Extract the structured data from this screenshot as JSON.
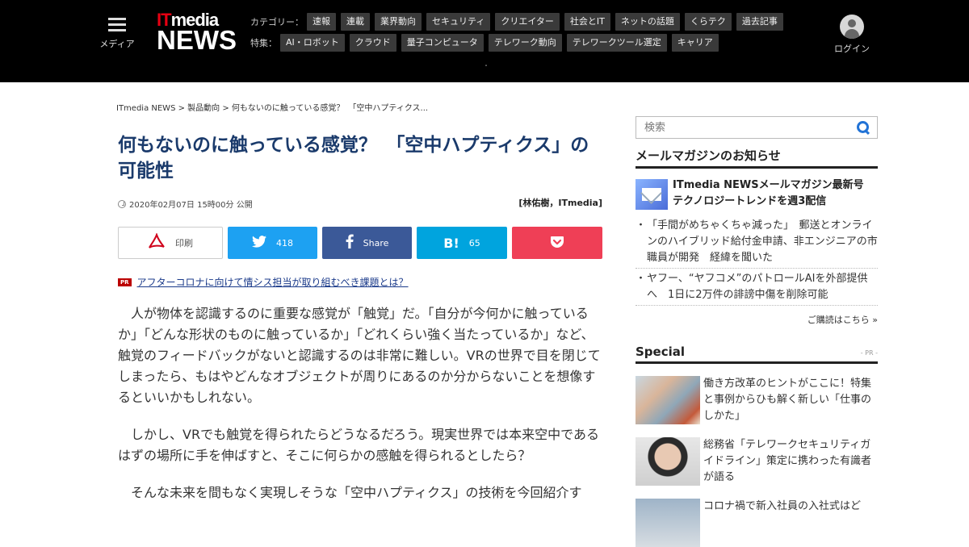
{
  "header": {
    "menu_label": "メディア",
    "logo_it": "IT",
    "logo_media": "media",
    "logo_news": "NEWS",
    "category_label": "カテゴリー：",
    "categories": [
      "速報",
      "連載",
      "業界動向",
      "セキュリティ",
      "クリエイター",
      "社会とIT",
      "ネットの話題",
      "くらテク",
      "過去記事"
    ],
    "feature_label": "特集：",
    "features": [
      "AI・ロボット",
      "クラウド",
      "量子コンピュータ",
      "テレワーク動向",
      "テレワークツール選定",
      "キャリア"
    ],
    "nav_dot": "・",
    "login_label": "ログイン"
  },
  "article": {
    "breadcrumb": [
      "ITmedia NEWS",
      "製品動向",
      "何もないのに触っている感覚？　「空中ハプティクス..."
    ],
    "breadcrumb_sep": " > ",
    "title": "何もないのに触っている感覚？　「空中ハプティクス」の可能性",
    "date": "2020年02月07日 15時00分 公開",
    "author": "[林佑樹，ITmedia]",
    "share": {
      "print_label": "印刷",
      "twitter_count": "418",
      "facebook_label": "Share",
      "hatena_icon": "B!",
      "hatena_count": "65"
    },
    "pr_badge": "PR",
    "pr_link": "アフターコロナに向けて情シス担当が取り組むべき課題とは？",
    "paragraphs": [
      "人が物体を認識するのに重要な感覚が「触覚」だ。「自分が今何かに触っているか」「どんな形状のものに触っているか」「どれくらい強く当たっているか」など、触覚のフィードバックがないと認識するのは非常に難しい。VRの世界で目を閉じてしまったら、もはやどんなオブジェクトが周りにあるのか分からないことを想像するといいかもしれない。",
      "しかし、VRでも触覚を得られたらどうなるだろう。現実世界では本来空中であるはずの場所に手を伸ばすと、そこに何らかの感触を得られるとしたら？",
      "そんな未来を間もなく実現しそうな「空中ハプティクス」の技術を今回紹介す"
    ]
  },
  "sidebar": {
    "search_placeholder": "検索",
    "mail_title": "メールマガジンのお知らせ",
    "mail_feature": "ITmedia NEWSメールマガジン最新号\nテクノロジートレンドを週3配信",
    "mail_items": [
      "「手間がめちゃくちゃ減った」　郵送とオンラインのハイブリッド給付金申請、非エンジニアの市職員が開発　経緯を聞いた",
      "ヤフー、“ヤフコメ”のパトロールAIを外部提供へ　1日に2万件の誹謗中傷を削除可能"
    ],
    "subscribe": "ご購読はこちら »",
    "special_title": "Special",
    "special_pr": "- PR -",
    "special_items": [
      "働き方改革のヒントがここに！特集と事例からひも解く新しい「仕事のしかた」",
      "総務省「テレワークセキュリティガイドライン」策定に携わった有識者が語る",
      "コロナ禍で新入社員の入社式はど"
    ]
  },
  "colors": {
    "title": "#1a3a6b",
    "twitter": "#1da1f2",
    "facebook": "#3b5998",
    "hatena": "#00a4de",
    "pocket": "#ef3f56",
    "logo_red": "#e60012"
  }
}
